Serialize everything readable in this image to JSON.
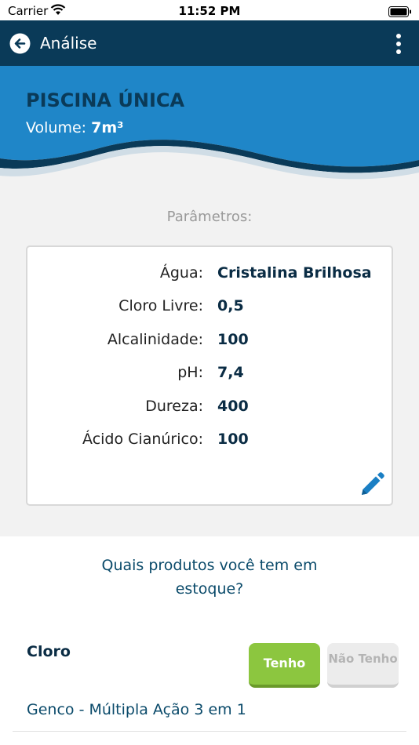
{
  "status_bar": {
    "carrier": "Carrier",
    "time": "11:52 PM"
  },
  "nav": {
    "title": "Análise",
    "back_icon": "arrow-left-circle-icon",
    "menu_icon": "more-vertical-icon"
  },
  "pool": {
    "name": "PISCINA ÚNICA",
    "volume_label": "Volume:",
    "volume_value": "7m³"
  },
  "parameters": {
    "title": "Parâmetros:",
    "rows": [
      {
        "label": "Água:",
        "value": "Cristalina Brilhosa"
      },
      {
        "label": "Cloro Livre:",
        "value": "0,5"
      },
      {
        "label": "Alcalinidade:",
        "value": "100"
      },
      {
        "label": "pH:",
        "value": "7,4"
      },
      {
        "label": "Dureza:",
        "value": "400"
      },
      {
        "label": "Ácido Cianúrico:",
        "value": "100"
      }
    ],
    "edit_icon": "pencil-icon"
  },
  "stock": {
    "question": "Quais produtos você tem em estoque?",
    "category": "Cloro",
    "have_label": "Tenho",
    "not_have_label": "Não Tenho",
    "product_name": "Genco - Múltipla Ação 3 em 1"
  },
  "colors": {
    "nav_bg": "#0a3a58",
    "header_blue": "#1f86c8",
    "have_green": "#8cc63f",
    "dark_text": "#0a2c44"
  }
}
